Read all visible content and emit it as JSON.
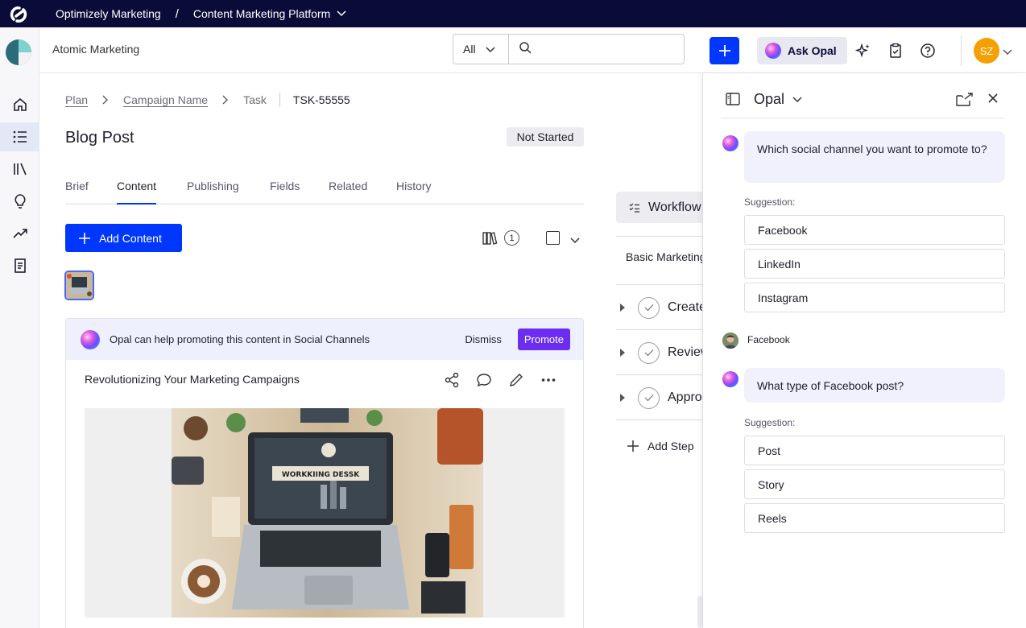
{
  "topbar": {
    "app_name": "Optimizely Marketing",
    "separator": "/",
    "platform": "Content Marketing Platform"
  },
  "header": {
    "project": "Atomic Marketing",
    "search_scope": "All",
    "search_placeholder": "",
    "ask_opal": "Ask Opal",
    "avatar_initials": "SZ"
  },
  "rail": {
    "items": [
      "home-icon",
      "list-icon",
      "library-icon",
      "lightbulb-icon",
      "trending-icon",
      "document-icon"
    ],
    "active_index": 1
  },
  "breadcrumb": {
    "plan": "Plan",
    "campaign": "Campaign Name",
    "task": "Task",
    "task_id": "TSK-55555"
  },
  "page": {
    "title": "Blog Post",
    "status": "Not Started"
  },
  "tabs": [
    {
      "label": "Brief"
    },
    {
      "label": "Content"
    },
    {
      "label": "Publishing"
    },
    {
      "label": "Fields"
    },
    {
      "label": "Related"
    },
    {
      "label": "History"
    }
  ],
  "active_tab": 1,
  "toolbar": {
    "add_content": "Add Content",
    "library_count": "1"
  },
  "card": {
    "banner_text": "Opal can help promoting this content in Social Channels",
    "dismiss": "Dismiss",
    "promote": "Promote",
    "title": "Revolutionizing Your Marketing Campaigns",
    "image_text": "WORKKIING DESSK"
  },
  "workflow": {
    "header": "Workflow",
    "name": "Basic Marketing",
    "steps": [
      {
        "label": "Create"
      },
      {
        "label": "Review"
      },
      {
        "label": "Approve"
      }
    ],
    "add_step": "Add Step"
  },
  "opal": {
    "title": "Opal",
    "q1": "Which social channel you want to promote to?",
    "suggestion_label": "Suggestion:",
    "options1": [
      "Facebook",
      "LinkedIn",
      "Instagram"
    ],
    "user_reply": "Facebook",
    "q2": "What type of Facebook post?",
    "options2": [
      "Post",
      "Story",
      "Reels"
    ]
  },
  "colors": {
    "topbar": "#0b0b3a",
    "primary": "#0037ff",
    "promote": "#6b2df0",
    "avatar": "#f5a000"
  }
}
